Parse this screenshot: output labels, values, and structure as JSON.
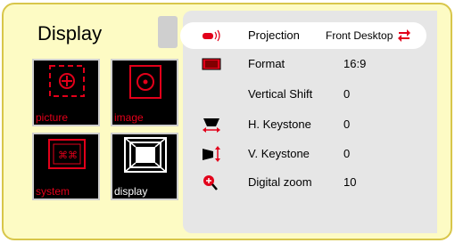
{
  "header": {
    "title": "Display"
  },
  "menu_tiles": [
    {
      "id": "picture",
      "label": "picture"
    },
    {
      "id": "image",
      "label": "image"
    },
    {
      "id": "system",
      "label": "system"
    },
    {
      "id": "display",
      "label": "display"
    }
  ],
  "settings": [
    {
      "id": "projection",
      "label": "Projection",
      "value": "Front Desktop",
      "icon": "projection-icon",
      "selected": true
    },
    {
      "id": "format",
      "label": "Format",
      "value": "16:9",
      "icon": "format-icon"
    },
    {
      "id": "vertical-shift",
      "label": "Vertical Shift",
      "value": "0",
      "icon": ""
    },
    {
      "id": "h-keystone",
      "label": "H. Keystone",
      "value": "0",
      "icon": "h-keystone-icon"
    },
    {
      "id": "v-keystone",
      "label": "V. Keystone",
      "value": "0",
      "icon": "v-keystone-icon"
    },
    {
      "id": "digital-zoom",
      "label": "Digital zoom",
      "value": "10",
      "icon": "zoom-icon"
    }
  ],
  "colors": {
    "accent_red": "#e2001a",
    "frame_yellow": "#fdfbc4",
    "panel_gray": "#e6e6e6"
  }
}
